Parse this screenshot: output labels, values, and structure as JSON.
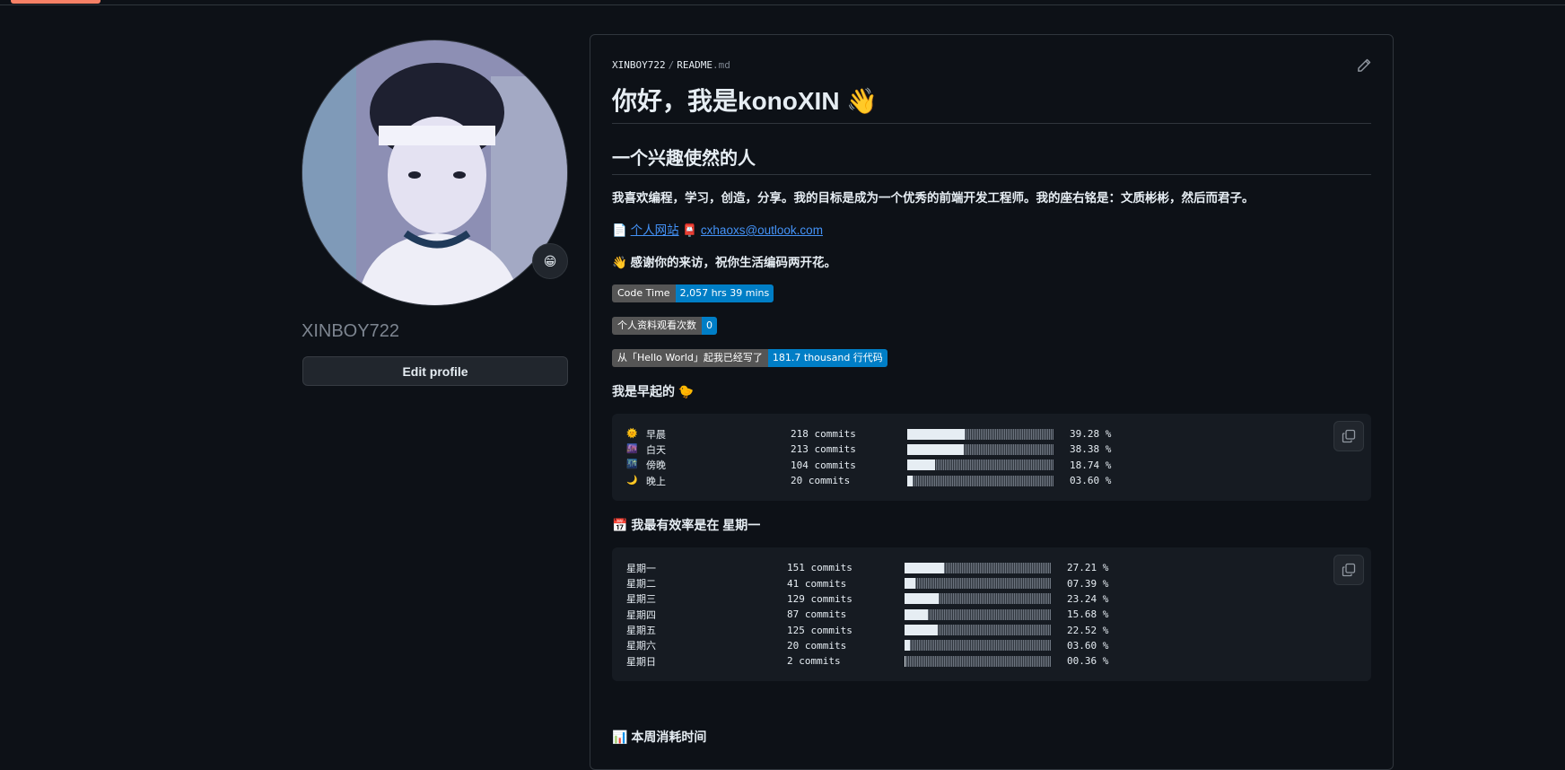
{
  "profile": {
    "username": "XINBOY722",
    "edit_button": "Edit profile",
    "status_emoji": "😁"
  },
  "readme": {
    "breadcrumb_user": "XINBOY722",
    "breadcrumb_sep": "/",
    "breadcrumb_file": "README",
    "breadcrumb_ext": ".md",
    "title": "你好，我是konoXIN 👋",
    "subtitle": "一个兴趣使然的人",
    "intro_prefix": "我喜欢编程，学习，创造，分享。我的目标是成为一个优秀的前端开发工程师。我的座右铭是：",
    "intro_motto": "文质彬彬，然后而君子。",
    "doc_icon": "📄",
    "website_link": "个人网站",
    "mail_icon": "📮",
    "email_link": "cxhaoxs@outlook.com",
    "thanks": "👋 感谢你的来访，祝你生活编码两开花。",
    "badges": [
      {
        "left": "Code Time",
        "right": "2,057 hrs 39 mins"
      },
      {
        "left": "个人资料观看次数",
        "right": "0"
      },
      {
        "left": "从「Hello World」起我已经写了",
        "right": "181.7 thousand 行代码"
      }
    ],
    "early_heading": "我是早起的 🐤",
    "time_of_day": [
      {
        "icon": "🌞",
        "label": "早晨",
        "commits": "218 commits",
        "percent": "39.28 %",
        "value": 39.28
      },
      {
        "icon": "🌆",
        "label": "白天",
        "commits": "213 commits",
        "percent": "38.38 %",
        "value": 38.38
      },
      {
        "icon": "🌃",
        "label": "傍晚",
        "commits": "104 commits",
        "percent": "18.74 %",
        "value": 18.74
      },
      {
        "icon": "🌙",
        "label": "晚上",
        "commits": "20 commits",
        "percent": "03.60 %",
        "value": 3.6
      }
    ],
    "weekday_heading": "📅 我最有效率是在 星期一",
    "weekdays": [
      {
        "label": "星期一",
        "commits": "151 commits",
        "percent": "27.21 %",
        "value": 27.21
      },
      {
        "label": "星期二",
        "commits": "41 commits",
        "percent": "07.39 %",
        "value": 7.39
      },
      {
        "label": "星期三",
        "commits": "129 commits",
        "percent": "23.24 %",
        "value": 23.24
      },
      {
        "label": "星期四",
        "commits": "87 commits",
        "percent": "15.68 %",
        "value": 15.68
      },
      {
        "label": "星期五",
        "commits": "125 commits",
        "percent": "22.52 %",
        "value": 22.52
      },
      {
        "label": "星期六",
        "commits": "20 commits",
        "percent": "03.60 %",
        "value": 3.6
      },
      {
        "label": "星期日",
        "commits": "2 commits",
        "percent": "00.36 %",
        "value": 0.36
      }
    ],
    "week_time_heading": "📊 本周消耗时间"
  }
}
